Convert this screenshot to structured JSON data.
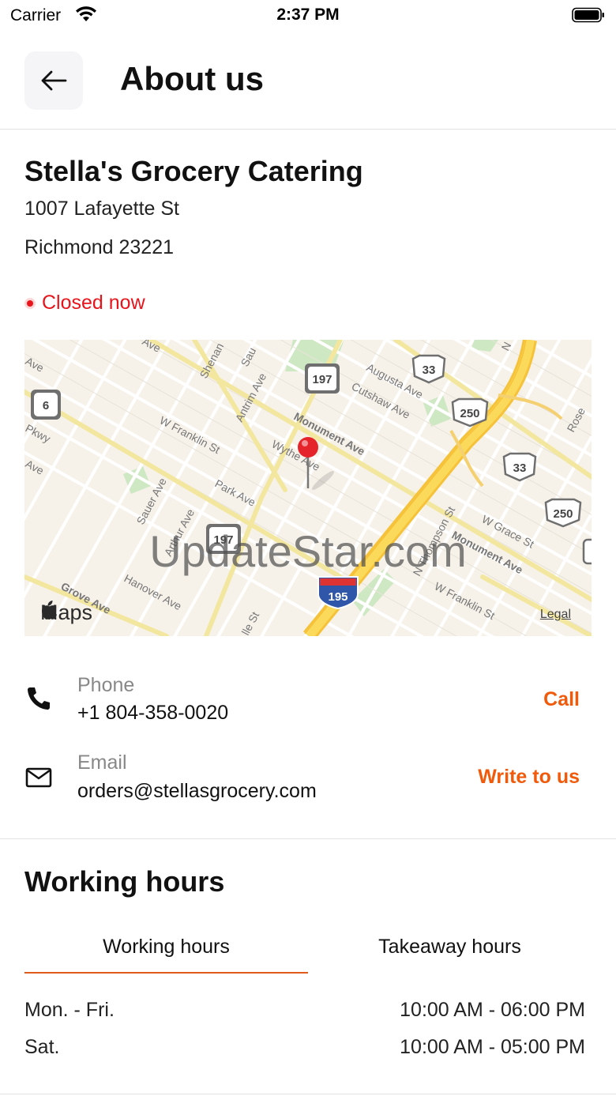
{
  "status_bar": {
    "carrier": "Carrier",
    "time": "2:37 PM"
  },
  "header": {
    "title": "About us",
    "back_icon": "arrow-left-icon"
  },
  "business": {
    "name": "Stella's Grocery Catering",
    "address_line1": "1007 Lafayette St",
    "address_line2": "Richmond 23221",
    "status": "Closed now"
  },
  "map": {
    "watermark": "UpdateStar.com",
    "brand": "Maps",
    "legal": "Legal",
    "street_labels": [
      "Ave",
      "Pkwy",
      "Ave",
      "Shenan",
      "Sau",
      "W Franklin St",
      "Antrim Ave",
      "Wythe Ave",
      "Monument Ave",
      "Augusta Ave",
      "Cutshaw Ave",
      "Park Ave",
      "Sauer Ave",
      "Grove Ave",
      "Hanover Ave",
      "Arthur Ave",
      "N Thompson St",
      "Monument Ave",
      "W Grace St",
      "W Franklin St",
      "Rose",
      "N",
      "lle St"
    ],
    "route_shields": [
      "197",
      "197",
      "6",
      "33",
      "250",
      "33",
      "250",
      "195"
    ]
  },
  "contact": {
    "phone_label": "Phone",
    "phone_value": "+1 804-358-0020",
    "phone_action": "Call",
    "email_label": "Email",
    "email_value": "orders@stellasgrocery.com",
    "email_action": "Write to us"
  },
  "working_hours": {
    "title": "Working hours",
    "tabs": [
      "Working hours",
      "Takeaway hours"
    ],
    "active_tab": 0,
    "rows": [
      {
        "day": "Mon. - Fri.",
        "time": "10:00 AM - 06:00 PM"
      },
      {
        "day": "Sat.",
        "time": "10:00 AM - 05:00 PM"
      }
    ]
  },
  "colors": {
    "accent": "#f05a0a",
    "closed": "#e8141c",
    "tab_underline": "#e05a1c"
  }
}
